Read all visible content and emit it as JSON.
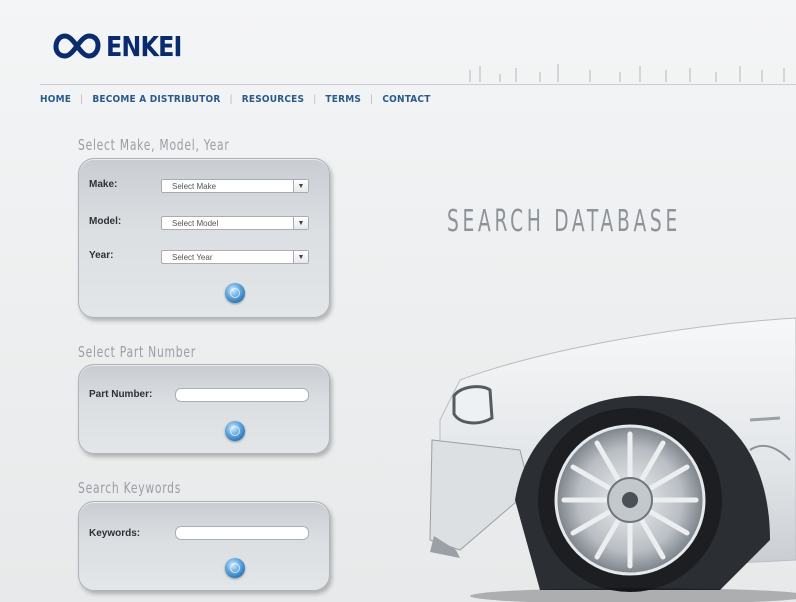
{
  "brand": {
    "name": "ENKEI",
    "logo_icon": "infinity-mark-icon"
  },
  "nav": {
    "items": [
      "HOME",
      "BECOME A DISTRIBUTOR",
      "RESOURCES",
      "TERMS",
      "CONTACT"
    ],
    "separator": "|"
  },
  "sections": {
    "make_model_year": {
      "title": "Select Make, Model, Year",
      "make_label": "Make:",
      "make_value": "Select Make",
      "model_label": "Model:",
      "model_value": "Select Model",
      "year_label": "Year:",
      "year_value": "Select Year"
    },
    "part_number": {
      "title": "Select Part Number",
      "label": "Part Number:",
      "value": ""
    },
    "keywords": {
      "title": "Search Keywords",
      "label": "Keywords:",
      "value": ""
    }
  },
  "hero": {
    "heading": "SEARCH DATABASE",
    "image": "car-wheel-illustration"
  },
  "colors": {
    "brand_blue": "#0a2c6e",
    "nav_blue": "#2a5a8c",
    "button_blue": "#1f6fb3"
  }
}
